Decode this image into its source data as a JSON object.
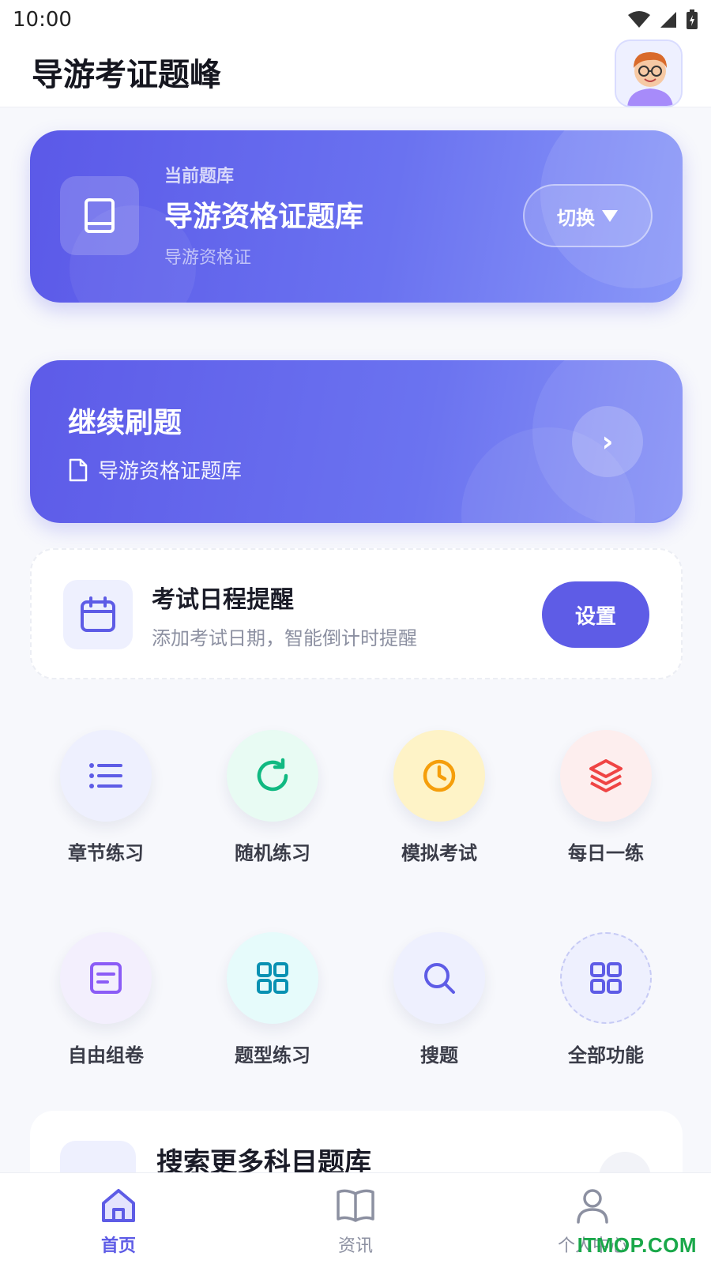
{
  "status_bar": {
    "time": "10:00"
  },
  "header": {
    "title": "导游考证题峰"
  },
  "current_bank": {
    "label": "当前题库",
    "name": "导游资格证题库",
    "subtitle": "导游资格证",
    "switch_label": "切换"
  },
  "continue": {
    "title": "继续刷题",
    "bank_name": "导游资格证题库",
    "arrow": "›"
  },
  "reminder": {
    "title": "考试日程提醒",
    "subtitle": "添加考试日期，智能倒计时提醒",
    "button": "设置"
  },
  "features": [
    {
      "label": "章节练习",
      "icon": "list-icon",
      "color": "#5e5ce6",
      "bg": "#eef0fe"
    },
    {
      "label": "随机练习",
      "icon": "refresh-icon",
      "color": "#10b981",
      "bg": "#e8fbf3"
    },
    {
      "label": "模拟考试",
      "icon": "clock-icon",
      "color": "#f59e0b",
      "bg": "#fef3c7"
    },
    {
      "label": "每日一练",
      "icon": "layers-icon",
      "color": "#ef4444",
      "bg": "#fdeeee"
    },
    {
      "label": "自由组卷",
      "icon": "document-icon",
      "color": "#8b5cf6",
      "bg": "#f3effd"
    },
    {
      "label": "题型练习",
      "icon": "grid-icon",
      "color": "#0891b2",
      "bg": "#e6fbfb"
    },
    {
      "label": "搜题",
      "icon": "search-icon",
      "color": "#5e5ce6",
      "bg": "#eef0fe"
    },
    {
      "label": "全部功能",
      "icon": "apps-icon",
      "color": "#5e5ce6",
      "bg": "#eef0fe"
    }
  ],
  "more_card": {
    "title": "搜索更多科目题库"
  },
  "tabs": [
    {
      "label": "首页",
      "icon": "home-icon",
      "active": true
    },
    {
      "label": "资讯",
      "icon": "book-icon",
      "active": false
    },
    {
      "label": "个人中心",
      "icon": "user-icon",
      "active": false
    }
  ],
  "watermark": "ITMOP.COM",
  "colors": {
    "accent": "#5e5ce6",
    "background": "#f7f8fc"
  }
}
